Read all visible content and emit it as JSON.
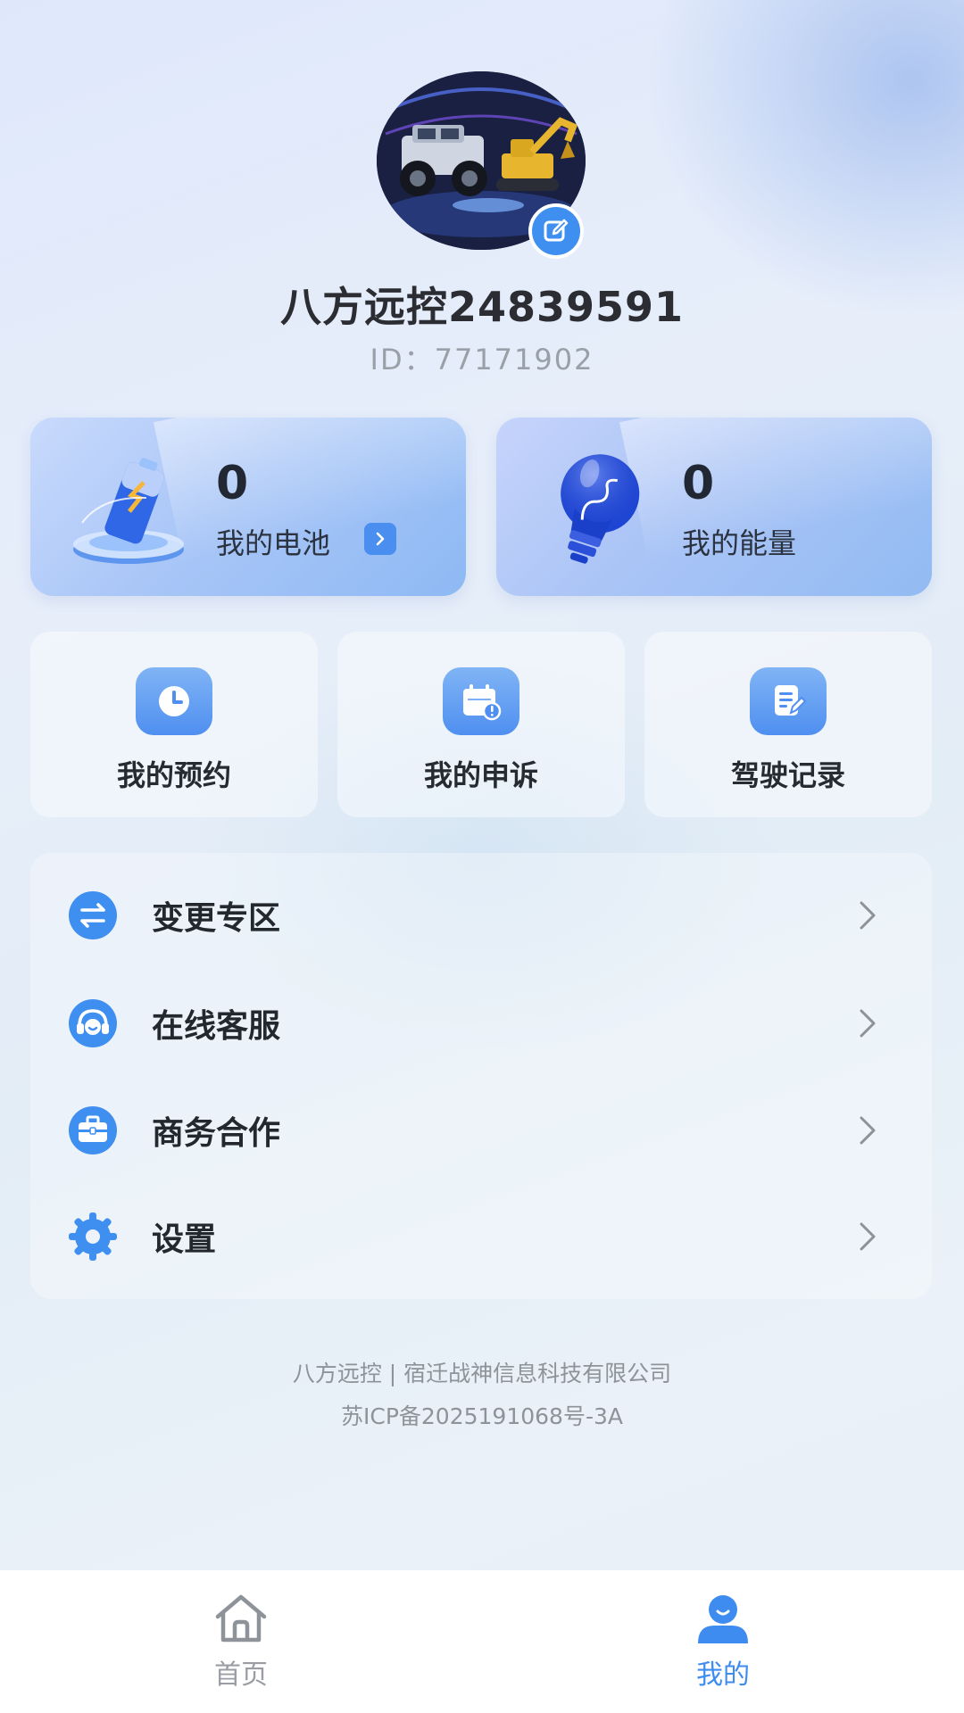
{
  "profile": {
    "username": "八方远控24839591",
    "user_id": "ID：77171902",
    "avatar_icon": "vehicles-photo-avatar",
    "edit_icon": "edit-icon"
  },
  "stats": {
    "battery": {
      "value": "0",
      "label": "我的电池",
      "icon": "battery-icon"
    },
    "energy": {
      "value": "0",
      "label": "我的能量",
      "icon": "lightbulb-icon"
    }
  },
  "quick_actions": [
    {
      "label": "我的预约",
      "icon": "clock-icon"
    },
    {
      "label": "我的申诉",
      "icon": "calendar-alert-icon"
    },
    {
      "label": "驾驶记录",
      "icon": "document-edit-icon"
    }
  ],
  "menu": [
    {
      "label": "变更专区",
      "icon": "swap-icon"
    },
    {
      "label": "在线客服",
      "icon": "headset-icon"
    },
    {
      "label": "商务合作",
      "icon": "briefcase-icon"
    },
    {
      "label": "设置",
      "icon": "gear-icon"
    }
  ],
  "footer": {
    "line1": "八方远控 | 宿迁战神信息科技有限公司",
    "line2": "苏ICP备2025191068号-3A"
  },
  "tabbar": {
    "items": [
      {
        "label": "首页",
        "icon": "home-icon",
        "active": false
      },
      {
        "label": "我的",
        "icon": "user-icon",
        "active": true
      }
    ]
  },
  "colors": {
    "accent": "#3e8cf0",
    "text_primary": "#262a31",
    "text_muted": "#9aa0a8"
  }
}
